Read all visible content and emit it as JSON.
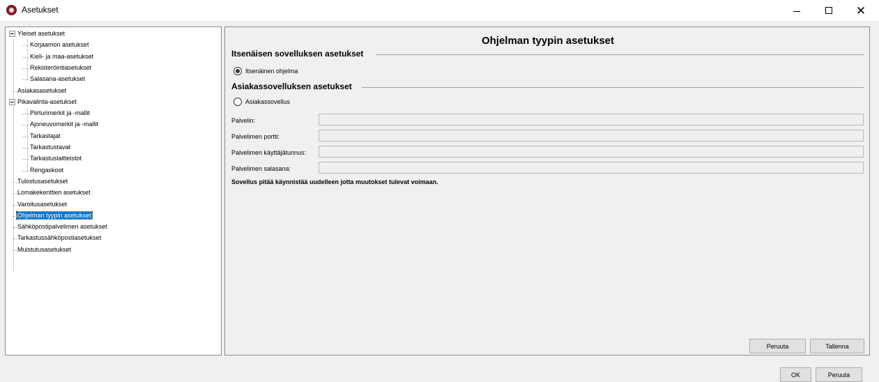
{
  "window": {
    "title": "Asetukset",
    "controls": {
      "minimize": "–",
      "maximize": "□",
      "close": "✕"
    }
  },
  "tree": {
    "items": [
      {
        "label": "Yleiset asetukset",
        "level": 0,
        "expanded": true,
        "selected": false
      },
      {
        "label": "Korjaamon asetukset",
        "level": 1,
        "selected": false
      },
      {
        "label": "Kieli- ja maa-asetukset",
        "level": 1,
        "selected": false
      },
      {
        "label": "Rekisteröintiasetukset",
        "level": 1,
        "selected": false
      },
      {
        "label": "Salasana-asetukset",
        "level": 1,
        "selected": false
      },
      {
        "label": "Asiakasasetukset",
        "level": 0,
        "selected": false
      },
      {
        "label": "Pikavalinta-asetukset",
        "level": 0,
        "expanded": true,
        "selected": false
      },
      {
        "label": "Piirturimerkit ja -mallit",
        "level": 1,
        "selected": false
      },
      {
        "label": "Ajoneuvomerkit ja -mallit",
        "level": 1,
        "selected": false
      },
      {
        "label": "Tarkastajat",
        "level": 1,
        "selected": false
      },
      {
        "label": "Tarkastustavat",
        "level": 1,
        "selected": false
      },
      {
        "label": "Tarkastuslaitteistot",
        "level": 1,
        "selected": false
      },
      {
        "label": "Rengaskoot",
        "level": 1,
        "selected": false
      },
      {
        "label": "Tulostusasetukset",
        "level": 0,
        "selected": false
      },
      {
        "label": "Lomakekenttien asetukset",
        "level": 0,
        "selected": false
      },
      {
        "label": "Varoitusasetukset",
        "level": 0,
        "selected": false
      },
      {
        "label": "Ohjelman tyypin asetukset",
        "level": 0,
        "selected": true
      },
      {
        "label": "Sähköpostipalvelimen asetukset",
        "level": 0,
        "selected": false
      },
      {
        "label": "Tarkastussähköpostiasetukset",
        "level": 0,
        "selected": false
      },
      {
        "label": "Muistutusasetukset",
        "level": 0,
        "selected": false
      }
    ]
  },
  "content": {
    "title": "Ohjelman tyypin asetukset",
    "standalone": {
      "heading": "Itsenäisen sovelluksen asetukset",
      "radio_label": "Itsenäinen ohjelma",
      "checked": true
    },
    "client": {
      "heading": "Asiakassovelluksen asetukset",
      "radio_label": "Asiakassovellus",
      "checked": false,
      "fields": {
        "server": {
          "label": "Palvelin:",
          "value": ""
        },
        "port": {
          "label": "Palvelimen portti:",
          "value": ""
        },
        "username": {
          "label": "Palvelimen käyttäjätunnus:",
          "value": ""
        },
        "password": {
          "label": "Palvelimen salasana:",
          "value": ""
        }
      }
    },
    "restart_note": "Sovellus pitää käynnistää uudelleen jotta muutokset tulevat voimaan.",
    "buttons": {
      "cancel": "Peruuta",
      "save": "Tallenna"
    }
  },
  "footer": {
    "ok": "OK",
    "cancel": "Peruuta"
  },
  "colors": {
    "selection": "#0078d7",
    "panel": "#f0f0f0",
    "app_icon": "#8a1f2a"
  }
}
